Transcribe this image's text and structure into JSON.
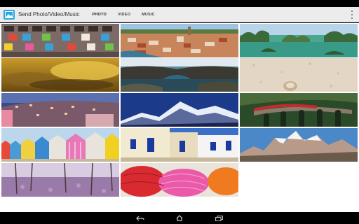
{
  "app": {
    "title": "Send Photo/Video/Music",
    "icon": "landscape-photo-icon"
  },
  "tabs": [
    {
      "label": "PHOTO",
      "active": true
    },
    {
      "label": "VIDEO",
      "active": false
    },
    {
      "label": "MUSIC",
      "active": false
    }
  ],
  "menu_icon": "overflow-menu-icon",
  "gallery": {
    "photos": [
      {
        "name": "photo-colorful-apartment-building"
      },
      {
        "name": "photo-coastal-town-aerial"
      },
      {
        "name": "photo-limestone-karst-bay"
      },
      {
        "name": "photo-golden-clouds"
      },
      {
        "name": "photo-rocky-coast-arch"
      },
      {
        "name": "photo-sandy-beach-shell"
      },
      {
        "name": "photo-hillside-town-dusk"
      },
      {
        "name": "photo-snowy-mountains-blue"
      },
      {
        "name": "photo-red-train-viaduct"
      },
      {
        "name": "photo-beach-huts"
      },
      {
        "name": "photo-white-village-blue-doors"
      },
      {
        "name": "photo-jagged-mountain-peaks"
      },
      {
        "name": "photo-lavender-field-trees"
      },
      {
        "name": "photo-yarn-skeins"
      }
    ]
  },
  "navbar": {
    "back": "back-icon",
    "home": "home-icon",
    "recents": "recents-icon"
  },
  "colors": {
    "accent": "#29a7e1",
    "actionbar": "#ececec"
  }
}
